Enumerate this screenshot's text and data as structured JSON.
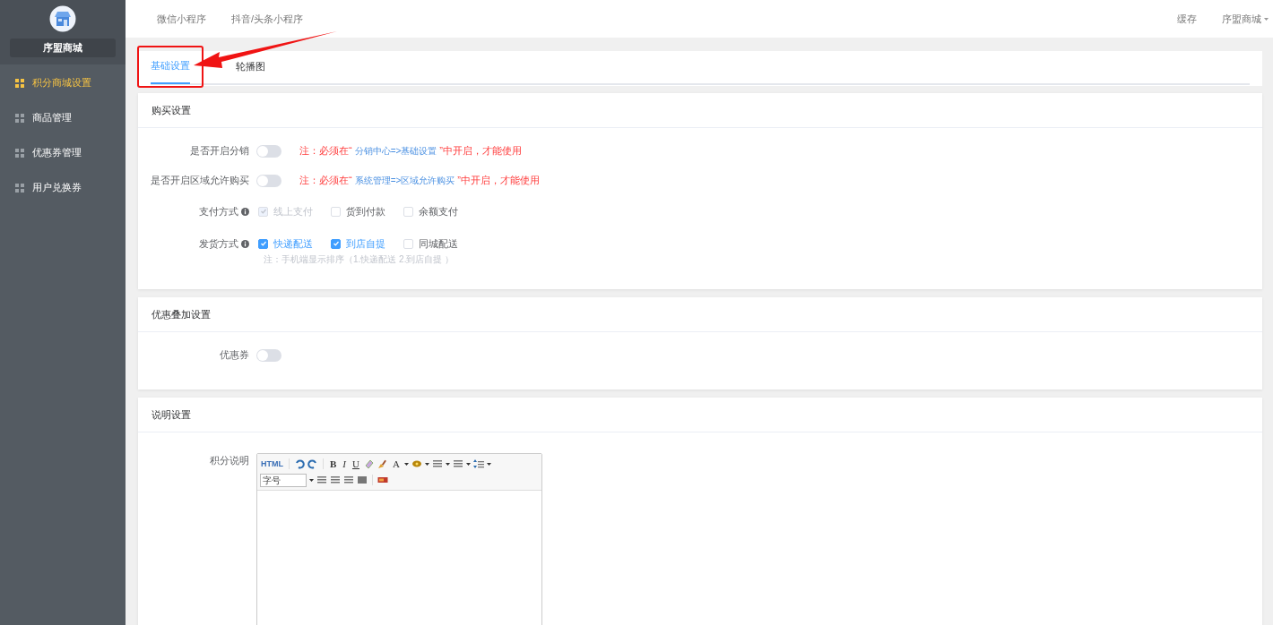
{
  "sidebar": {
    "brand": "序盟商城",
    "items": [
      {
        "label": "积分商城设置",
        "selected": true
      },
      {
        "label": "商品管理",
        "selected": false
      },
      {
        "label": "优惠券管理",
        "selected": false
      },
      {
        "label": "用户兑换券",
        "selected": false
      }
    ]
  },
  "top_nav": {
    "tabs": [
      "微信小程序",
      "抖音/头条小程序"
    ],
    "cache": "缓存",
    "account": "序盟商城"
  },
  "page_tabs": [
    {
      "label": "基础设置",
      "selected": true
    },
    {
      "label": "轮播图",
      "selected": false
    }
  ],
  "sections": [
    {
      "title": "购买设置",
      "rows": [
        {
          "kind": "switch",
          "label": "是否开启分销",
          "on": false,
          "note": {
            "prefix": "注：必须在“",
            "link": "分销中心=>基础设置",
            "suffix": "”中开启，才能使用"
          }
        },
        {
          "kind": "switch",
          "label": "是否开启区域允许购买",
          "on": false,
          "note": {
            "prefix": "注：必须在“",
            "link": "系统管理=>区域允许购买",
            "suffix": "”中开启，才能使用"
          }
        },
        {
          "kind": "checkboxes",
          "label": "支付方式",
          "options": [
            {
              "label": "线上支付",
              "checked": true,
              "disabled": true
            },
            {
              "label": "货到付款",
              "checked": false,
              "disabled": false
            },
            {
              "label": "余额支付",
              "checked": false,
              "disabled": false
            }
          ]
        },
        {
          "kind": "checkboxes",
          "label": "发货方式",
          "options": [
            {
              "label": "快递配送",
              "checked": true,
              "disabled": false
            },
            {
              "label": "到店自提",
              "checked": true,
              "disabled": false
            },
            {
              "label": "同城配送",
              "checked": false,
              "disabled": false
            }
          ],
          "hint": "注：手机端显示排序（1.快递配送 2.到店自提 ）"
        }
      ]
    },
    {
      "title": "优惠叠加设置",
      "rows": [
        {
          "kind": "switch",
          "label": "优惠券",
          "on": false
        }
      ]
    },
    {
      "title": "说明设置",
      "rows": [
        {
          "kind": "editor",
          "label": "积分说明",
          "text_buttons": [
            "HTML",
            "B",
            "I",
            "U",
            "A"
          ],
          "font_select": "字号"
        }
      ]
    }
  ]
}
